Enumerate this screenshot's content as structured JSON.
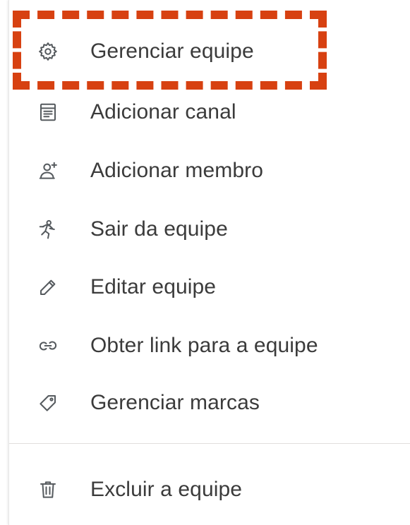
{
  "menu": {
    "items": [
      {
        "label": "Gerenciar equipe",
        "icon": "gear-icon"
      },
      {
        "label": "Adicionar canal",
        "icon": "channel-list-icon"
      },
      {
        "label": "Adicionar membro",
        "icon": "add-person-icon"
      },
      {
        "label": "Sair da equipe",
        "icon": "leave-person-icon"
      },
      {
        "label": "Editar equipe",
        "icon": "pencil-icon"
      },
      {
        "label": "Obter link para a equipe",
        "icon": "link-icon"
      },
      {
        "label": "Gerenciar marcas",
        "icon": "tag-icon"
      }
    ],
    "danger_items": [
      {
        "label": "Excluir a equipe",
        "icon": "trash-icon"
      }
    ]
  },
  "highlight": {
    "target": "Gerenciar equipe",
    "color": "#d74111",
    "style": "dashed"
  },
  "colors": {
    "text": "#3b3b3b",
    "icon": "#555a5e",
    "divider": "#e1dfdd",
    "background": "#ffffff"
  }
}
